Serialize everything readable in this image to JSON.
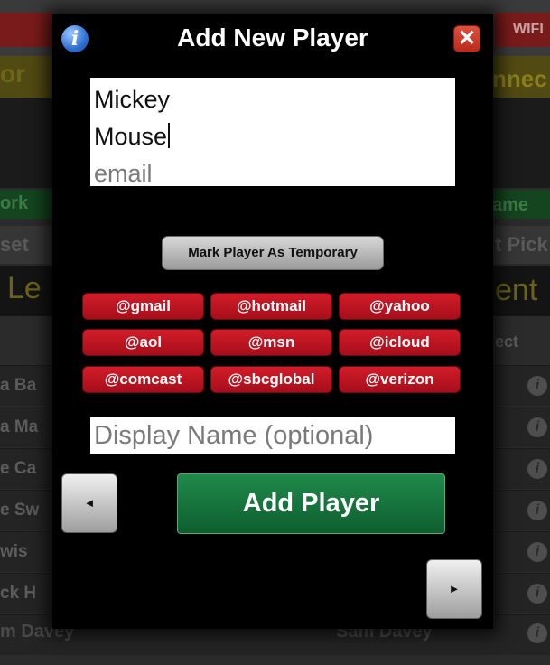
{
  "background": {
    "status_text": "WIFI",
    "yellow_left": "or",
    "yellow_right": "nnec",
    "green_left": "ork",
    "green_right": "ame",
    "grey_left": "set",
    "grey_right": "t Pick",
    "row_heading_left": "Le",
    "row_heading_right": "ent",
    "select_label": "ect",
    "rows": [
      "a Ba",
      "a Ma",
      "e Ca",
      "e Sw",
      "wis",
      "ck H"
    ],
    "bottom_left": "m Davey",
    "bottom_right": "Sam Davey"
  },
  "modal": {
    "title": "Add New Player",
    "first_name": "Mickey",
    "last_name": "Mouse",
    "email_placeholder": "email",
    "temporary_button": "Mark Player As Temporary",
    "domains": [
      "@gmail",
      "@hotmail",
      "@yahoo",
      "@aol",
      "@msn",
      "@icloud",
      "@comcast",
      "@sbcglobal",
      "@verizon"
    ],
    "display_name_placeholder": "Display Name (optional)",
    "add_button": "Add Player",
    "prev_glyph": "◄",
    "next_glyph": "►",
    "info_glyph": "i",
    "close_glyph": "✕"
  },
  "colors": {
    "domain_button": "#c8101f",
    "add_button": "#137a3c",
    "info_icon": "#2f6fd3",
    "close_button": "#d43b2b"
  },
  "icons": [
    "info-icon",
    "close-icon",
    "left-arrow-icon",
    "right-arrow-icon"
  ]
}
